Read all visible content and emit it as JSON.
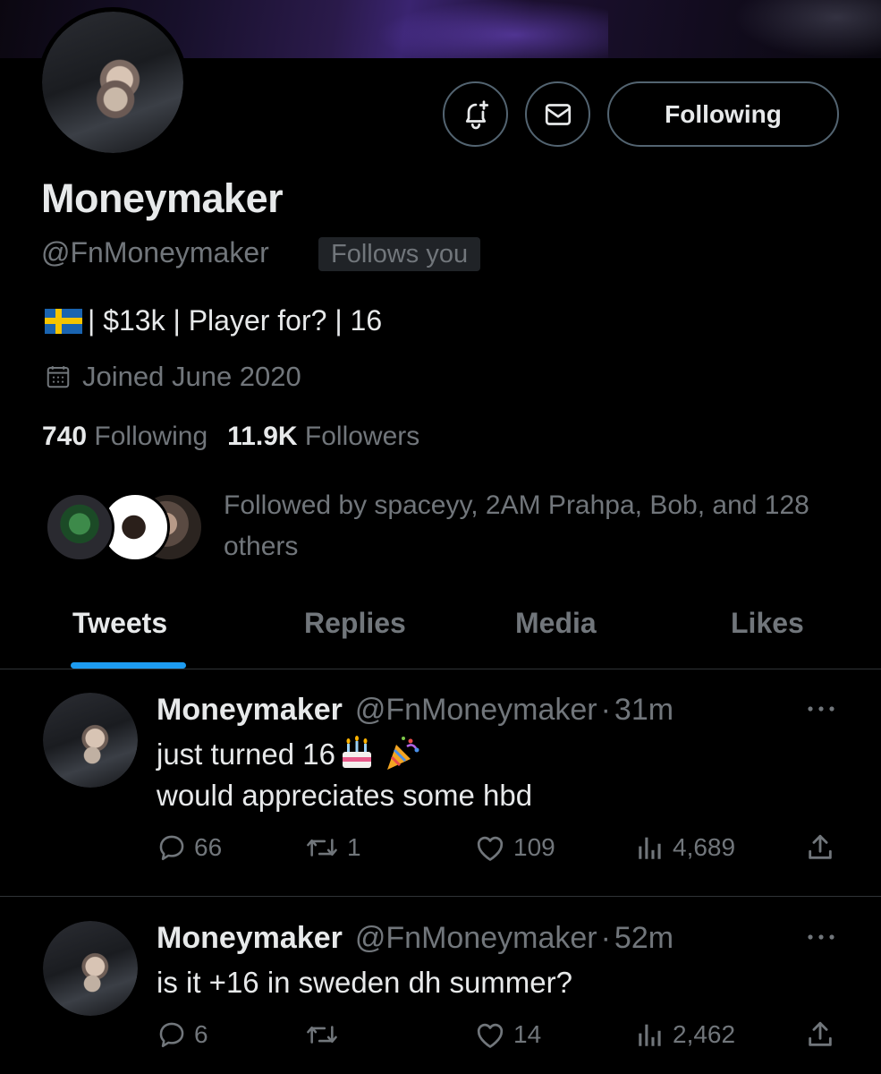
{
  "profile": {
    "name": "Moneymaker",
    "handle": "@FnMoneymaker",
    "follows_you": "Follows you",
    "bio_flag": "sweden-flag-icon",
    "bio": "| $13k | Player for? | 16",
    "joined": "Joined June 2020",
    "following_count": "740",
    "following_label": "Following",
    "followers_count": "11.9K",
    "followers_label": "Followers",
    "followed_by": "Followed by spaceyy, 2AM Prahpa, Bob, and 128 others"
  },
  "actions": {
    "following_button": "Following"
  },
  "tabs": [
    {
      "label": "Tweets",
      "active": true
    },
    {
      "label": "Replies",
      "active": false
    },
    {
      "label": "Media",
      "active": false
    },
    {
      "label": "Likes",
      "active": false
    }
  ],
  "tweets": [
    {
      "name": "Moneymaker",
      "handle": "@FnMoneymaker",
      "dot": "·",
      "time": "31m",
      "line1": "just turned 16",
      "line2": "would appreciates some hbd",
      "replies": "66",
      "retweets": "1",
      "likes": "109",
      "views": "4,689"
    },
    {
      "name": "Moneymaker",
      "handle": "@FnMoneymaker",
      "dot": "·",
      "time": "52m",
      "line1": "is it +16 in sweden dh summer?",
      "replies": "6",
      "retweets": "",
      "likes": "14",
      "views": "2,462"
    }
  ],
  "colors": {
    "background": "#000000",
    "text_primary": "#e7e9ea",
    "text_secondary": "#71767b",
    "accent": "#1d9bf0",
    "border": "#2f3336"
  }
}
